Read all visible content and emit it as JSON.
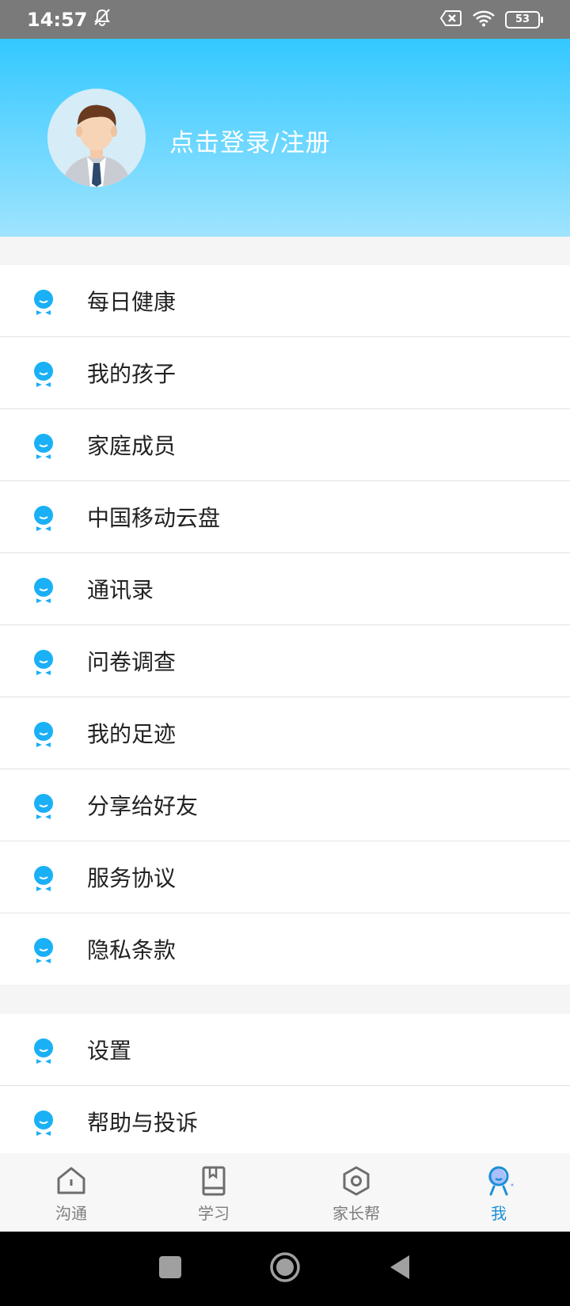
{
  "status_bar": {
    "time": "14:57",
    "battery": "53"
  },
  "header": {
    "login_text": "点击登录/注册"
  },
  "menu_group_1": [
    {
      "label": "每日健康"
    },
    {
      "label": "我的孩子"
    },
    {
      "label": "家庭成员"
    },
    {
      "label": "中国移动云盘"
    },
    {
      "label": "通讯录"
    },
    {
      "label": "问卷调查"
    },
    {
      "label": "我的足迹"
    },
    {
      "label": "分享给好友"
    },
    {
      "label": "服务协议"
    },
    {
      "label": "隐私条款"
    }
  ],
  "menu_group_2": [
    {
      "label": "设置"
    },
    {
      "label": "帮助与投诉"
    }
  ],
  "tabs": [
    {
      "label": "沟通",
      "icon": "home-icon"
    },
    {
      "label": "学习",
      "icon": "book-icon"
    },
    {
      "label": "家长帮",
      "icon": "hexagon-icon"
    },
    {
      "label": "我",
      "icon": "profile-icon",
      "active": true
    }
  ],
  "colors": {
    "accent": "#1ab0f5",
    "header_top": "#33c8ff",
    "header_bottom": "#9fe4ff",
    "active_tab": "#1a8fd6"
  }
}
